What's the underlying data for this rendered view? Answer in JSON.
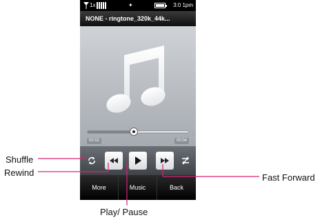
{
  "status_bar": {
    "network": "1x",
    "time": "3:0 1pm"
  },
  "now_playing": {
    "title": "NONE - ringtone_320k_44k...",
    "elapsed": "00:02",
    "total": "00:04",
    "progress": 0.46
  },
  "controls": {
    "shuffle_icon": "shuffle-icon",
    "rewind_icon": "rewind-icon",
    "play_icon": "play-icon",
    "fast_forward_icon": "fast-forward-icon",
    "repeat_icon": "repeat-icon"
  },
  "softkeys": {
    "more": "More",
    "music": "Music",
    "back": "Back"
  },
  "callouts": {
    "shuffle": "Shuffle",
    "rewind": "Rewind",
    "play_pause": "Play/ Pause",
    "fast_forward": "Fast Forward"
  },
  "colors": {
    "callout_line": "#d6237a"
  }
}
